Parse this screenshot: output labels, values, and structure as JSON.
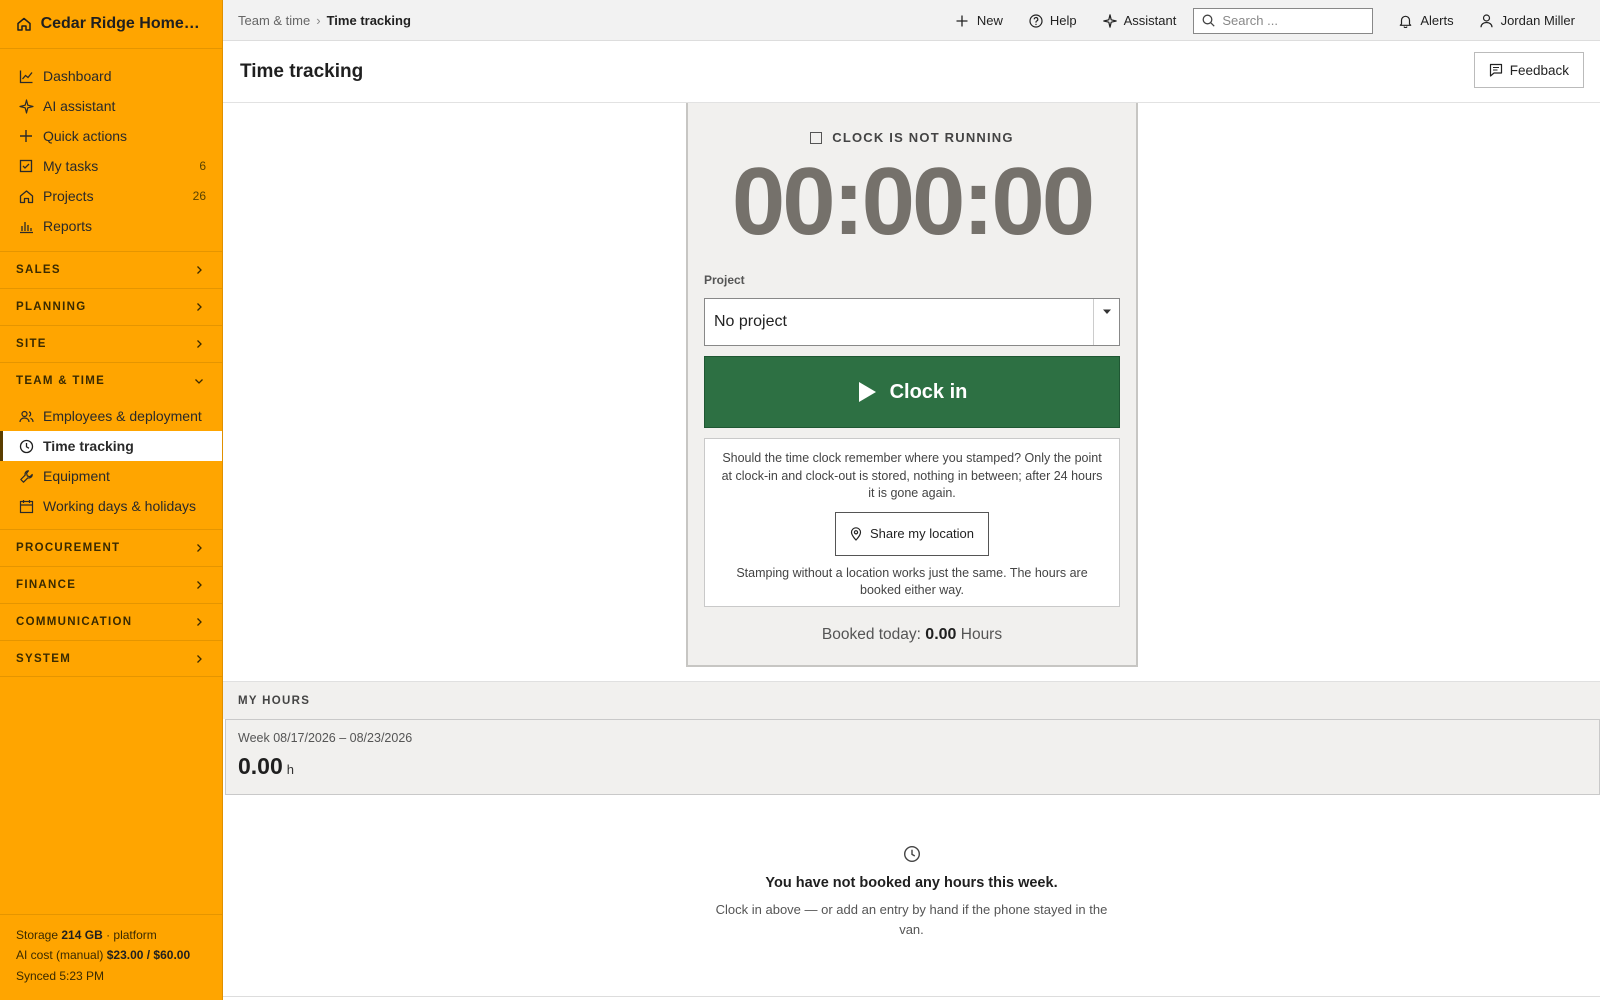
{
  "brand": {
    "name": "Cedar Ridge Homes L...",
    "icon": "home-icon"
  },
  "sidebar": {
    "primary": [
      {
        "label": "Dashboard",
        "icon": "chart-line-icon",
        "count": ""
      },
      {
        "label": "AI assistant",
        "icon": "sparkle-icon",
        "count": ""
      },
      {
        "label": "Quick actions",
        "icon": "plus-icon",
        "count": ""
      },
      {
        "label": "My tasks",
        "icon": "checkbox-icon",
        "count": "6"
      },
      {
        "label": "Projects",
        "icon": "house-icon",
        "count": "26"
      },
      {
        "label": "Reports",
        "icon": "bar-chart-icon",
        "count": ""
      }
    ],
    "sections": {
      "sales": "SALES",
      "planning": "PLANNING",
      "site": "SITE",
      "team_time": "TEAM & TIME",
      "procurement": "PROCUREMENT",
      "finance": "FINANCE",
      "communication": "COMMUNICATION",
      "system": "SYSTEM"
    },
    "team_items": [
      {
        "label": "Employees & deployment",
        "icon": "users-icon"
      },
      {
        "label": "Time tracking",
        "icon": "clock-icon",
        "active": true
      },
      {
        "label": "Equipment",
        "icon": "wrench-icon"
      },
      {
        "label": "Working days & holidays",
        "icon": "calendar-icon"
      }
    ],
    "footer": {
      "storage_label": "Storage",
      "storage_value": "214 GB",
      "storage_suffix": "· platform",
      "ai_cost_label": "AI cost (manual)",
      "ai_cost_value": "$23.00 / $60.00",
      "synced": "Synced 5:23 PM"
    }
  },
  "topbar": {
    "breadcrumb_parent": "Team & time",
    "breadcrumb_sep": "›",
    "breadcrumb_current": "Time tracking",
    "new_label": "New",
    "help_label": "Help",
    "assistant_label": "Assistant",
    "search_placeholder": "Search ...",
    "alerts_label": "Alerts",
    "user_name": "Jordan Miller"
  },
  "page": {
    "title": "Time tracking",
    "feedback_label": "Feedback"
  },
  "clock": {
    "status": "CLOCK IS NOT RUNNING",
    "timer": "00:00:00",
    "project_label": "Project",
    "project_value": "No project",
    "clock_in_label": "Clock in",
    "location_text": "Should the time clock remember where you stamped? Only the point at clock-in and clock-out is stored, nothing in between; after 24 hours it is gone again.",
    "share_location_label": "Share my location",
    "location_note": "Stamping without a location works just the same. The hours are booked either way.",
    "booked_prefix": "Booked today:",
    "booked_value": "0.00",
    "booked_unit": "Hours"
  },
  "my_hours": {
    "heading": "MY HOURS",
    "week_range": "Week 08/17/2026 – 08/23/2026",
    "week_total": "0.00",
    "week_unit": "h"
  },
  "empty_state": {
    "icon": "clock-icon",
    "title": "You have not booked any hours this week.",
    "description": "Clock in above — or add an entry by hand if the phone stayed in the van."
  },
  "colors": {
    "sidebar": "#ffa500",
    "clock_button": "#2d7043",
    "timer": "#75716b"
  }
}
